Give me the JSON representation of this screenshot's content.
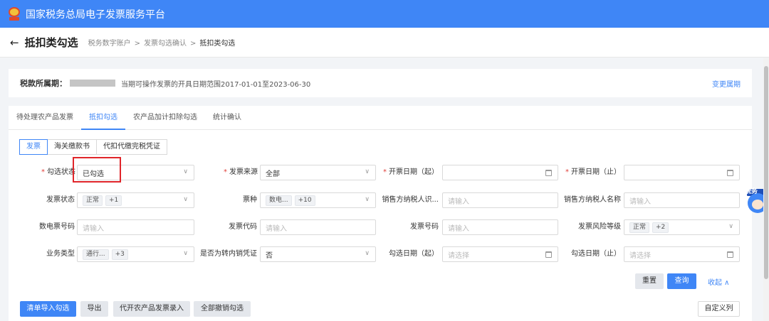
{
  "header": {
    "title": "国家税务总局电子发票服务平台"
  },
  "titlebar": {
    "back": "←",
    "title": "抵扣类勾选",
    "crumbs": [
      "税务数字账户",
      "发票勾选确认",
      "抵扣类勾选"
    ],
    "sep": ">"
  },
  "period": {
    "label": "税款所属期：",
    "desc": "当期可操作发票的开具日期范围2017-01-01至2023-06-30",
    "change": "变更属期"
  },
  "tabs": [
    "待处理农产品发票",
    "抵扣勾选",
    "农产品加计扣除勾选",
    "统计确认"
  ],
  "subtabs": [
    "发票",
    "海关缴款书",
    "代扣代缴完税凭证"
  ],
  "form": {
    "check_status": {
      "label": "勾选状态",
      "value": "已勾选"
    },
    "invoice_source": {
      "label": "发票来源",
      "value": "全部"
    },
    "issue_date_start": {
      "label": "开票日期（起）"
    },
    "issue_date_end": {
      "label": "开票日期（止）"
    },
    "invoice_status": {
      "label": "发票状态",
      "tag": "正常",
      "more": "+1"
    },
    "ticket_type": {
      "label": "票种",
      "tag": "数电...",
      "more": "+10"
    },
    "seller_id": {
      "label": "销售方纳税人识...",
      "placeholder": "请输入"
    },
    "seller_name": {
      "label": "销售方纳税人名称",
      "placeholder": "请输入"
    },
    "digital_no": {
      "label": "数电票号码",
      "placeholder": "请输入"
    },
    "invoice_code": {
      "label": "发票代码",
      "placeholder": "请输入"
    },
    "invoice_no": {
      "label": "发票号码",
      "placeholder": "请输入"
    },
    "risk_level": {
      "label": "发票风险等级",
      "tag": "正常",
      "more": "+2"
    },
    "biz_type": {
      "label": "业务类型",
      "tag": "通行...",
      "more": "+3"
    },
    "transfer_voucher": {
      "label": "是否为转内销凭证",
      "value": "否"
    },
    "check_date_start": {
      "label": "勾选日期（起）",
      "placeholder": "请选择"
    },
    "check_date_end": {
      "label": "勾选日期（止）",
      "placeholder": "请选择"
    }
  },
  "actions": {
    "reset": "重置",
    "query": "查询",
    "collapse": "收起 ∧"
  },
  "toolbar": {
    "import": "清单导入勾选",
    "export": "导出",
    "agri_entry": "代开农产品发票录入",
    "cancel_all": "全部撤销勾选",
    "custom_cols": "自定义列"
  },
  "mascot": {
    "text": "税务"
  }
}
